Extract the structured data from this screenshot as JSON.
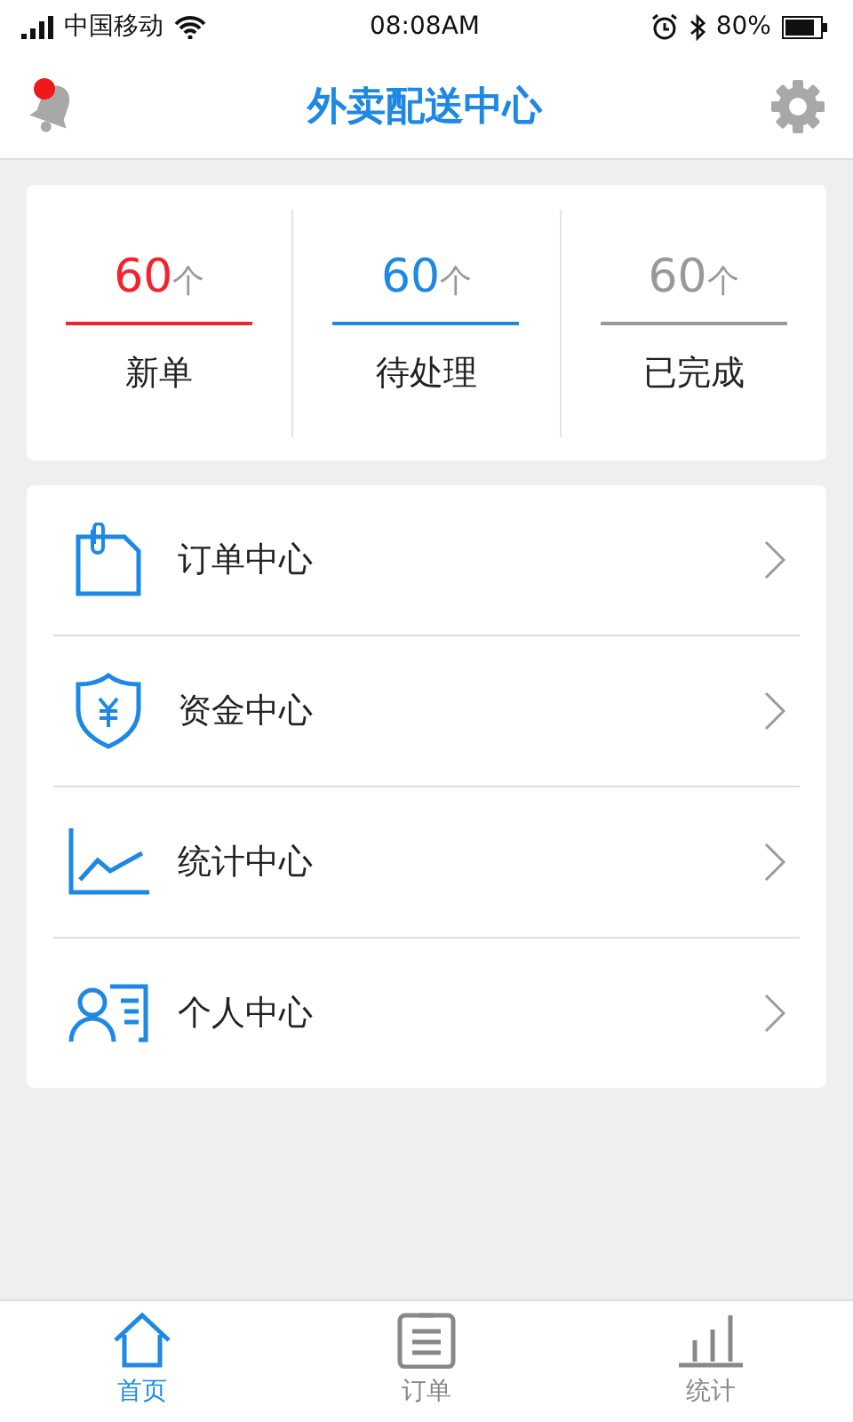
{
  "status_bar": {
    "carrier": "中国移动",
    "time": "08:08AM",
    "battery": "80%"
  },
  "header": {
    "title": "外卖配送中心"
  },
  "stats": [
    {
      "count": "60",
      "unit": "个",
      "label": "新单",
      "color": "#f5222d"
    },
    {
      "count": "60",
      "unit": "个",
      "label": "待处理",
      "color": "#1e88e5"
    },
    {
      "count": "60",
      "unit": "个",
      "label": "已完成",
      "color": "#999999"
    }
  ],
  "menu": [
    {
      "kind": "order",
      "label": "订单中心"
    },
    {
      "kind": "funds",
      "label": "资金中心"
    },
    {
      "kind": "stats",
      "label": "统计中心"
    },
    {
      "kind": "profile",
      "label": "个人中心"
    }
  ],
  "tab_bar": [
    {
      "kind": "home",
      "label": "首页",
      "selected": true
    },
    {
      "kind": "order",
      "label": "订单",
      "selected": false
    },
    {
      "kind": "stats",
      "label": "统计",
      "selected": false
    }
  ]
}
